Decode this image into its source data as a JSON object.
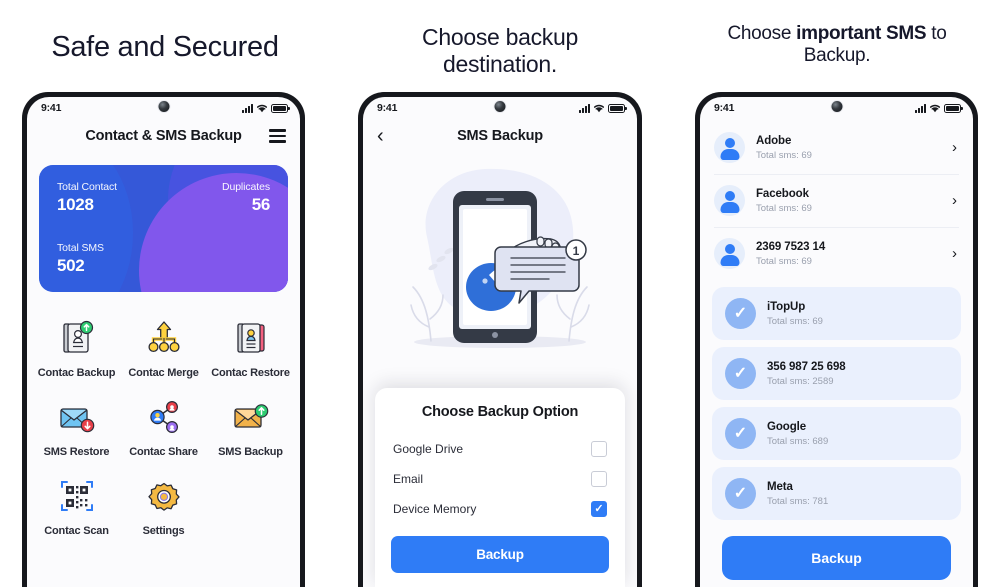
{
  "headings": {
    "panel1": "Safe and Secured",
    "panel2_line1": "Choose backup",
    "panel2_line2": "destination.",
    "panel3_pre": "Choose ",
    "panel3_bold": "important SMS",
    "panel3_post": " to",
    "panel3_line2": "Backup."
  },
  "colors": {
    "accent_blue": "#2f7cf6",
    "card_blue": "#3558d8",
    "card_purple": "#8157ec",
    "selected_row_bg": "#eaf0fd",
    "text_dark": "#16181d",
    "text_muted": "#9aa0ae"
  },
  "status_bar": {
    "time": "9:41",
    "icons": [
      "signal-icon",
      "wifi-icon",
      "battery-icon"
    ]
  },
  "phone1": {
    "appbar": {
      "title": "Contact & SMS Backup",
      "menu_icon": "hamburger-menu-icon"
    },
    "stats_card": {
      "total_contact_label": "Total Contact",
      "total_contact_value": "1028",
      "duplicates_label": "Duplicates",
      "duplicates_value": "56",
      "total_sms_label": "Total SMS",
      "total_sms_value": "502"
    },
    "grid": [
      {
        "label": "Contac Backup",
        "icon": "contact-book-upload-icon"
      },
      {
        "label": "Contac Merge",
        "icon": "merge-arrow-icon"
      },
      {
        "label": "Contac Restore",
        "icon": "contact-book-restore-icon"
      },
      {
        "label": "SMS Restore",
        "icon": "envelope-download-icon"
      },
      {
        "label": "Contac Share",
        "icon": "share-nodes-icon"
      },
      {
        "label": "SMS Backup",
        "icon": "envelope-upload-icon"
      },
      {
        "label": "Contac Scan",
        "icon": "qr-code-scan-icon"
      },
      {
        "label": "Settings",
        "icon": "gear-icon"
      }
    ]
  },
  "phone2": {
    "appbar": {
      "title": "SMS Backup",
      "back_icon": "back-chevron-icon"
    },
    "illustration": "person-holding-sms-bubble-illustration",
    "modal": {
      "title": "Choose Backup Option",
      "options": [
        {
          "label": "Google Drive",
          "checked": false
        },
        {
          "label": "Email",
          "checked": false
        },
        {
          "label": "Device Memory",
          "checked": true
        }
      ],
      "button": "Backup"
    }
  },
  "phone3": {
    "rows": [
      {
        "name": "Adobe",
        "sub": "Total sms: 69",
        "selected": false
      },
      {
        "name": "Facebook",
        "sub": "Total sms: 69",
        "selected": false
      },
      {
        "name": "2369 7523 14",
        "sub": "Total sms: 69",
        "selected": false
      },
      {
        "name": "iTopUp",
        "sub": "Total sms: 69",
        "selected": true
      },
      {
        "name": "356 987 25 698",
        "sub": "Total sms: 2589",
        "selected": true
      },
      {
        "name": "Google",
        "sub": "Total sms: 689",
        "selected": true
      },
      {
        "name": "Meta",
        "sub": "Total sms: 781",
        "selected": true
      }
    ],
    "button": "Backup"
  }
}
